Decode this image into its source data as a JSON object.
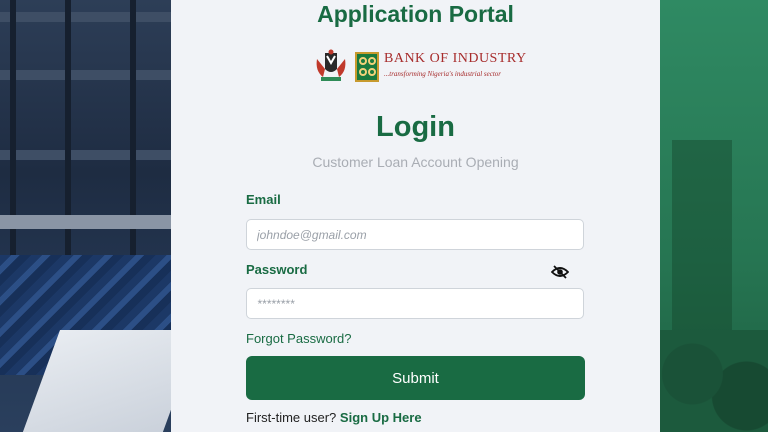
{
  "header": {
    "app_title": "Application Portal",
    "bank_name": "BANK OF INDUSTRY",
    "bank_tagline": "...transforming Nigeria's industrial sector"
  },
  "form": {
    "title": "Login",
    "subtitle": "Customer Loan Account Opening",
    "email_label": "Email",
    "email_placeholder": "johndoe@gmail.com",
    "email_value": "",
    "password_label": "Password",
    "password_placeholder": "********",
    "password_value": "",
    "forgot_label": "Forgot Password?",
    "submit_label": "Submit",
    "first_time_text": "First-time user?",
    "signup_label": "Sign Up Here"
  },
  "icons": {
    "password_toggle": "eye-slash-icon",
    "coat_of_arms": "coat-of-arms-icon",
    "bank_logo": "bank-logo-icon"
  },
  "colors": {
    "brand_green": "#196b43",
    "bank_red": "#a72c2c",
    "background": "#f1f3f7"
  }
}
